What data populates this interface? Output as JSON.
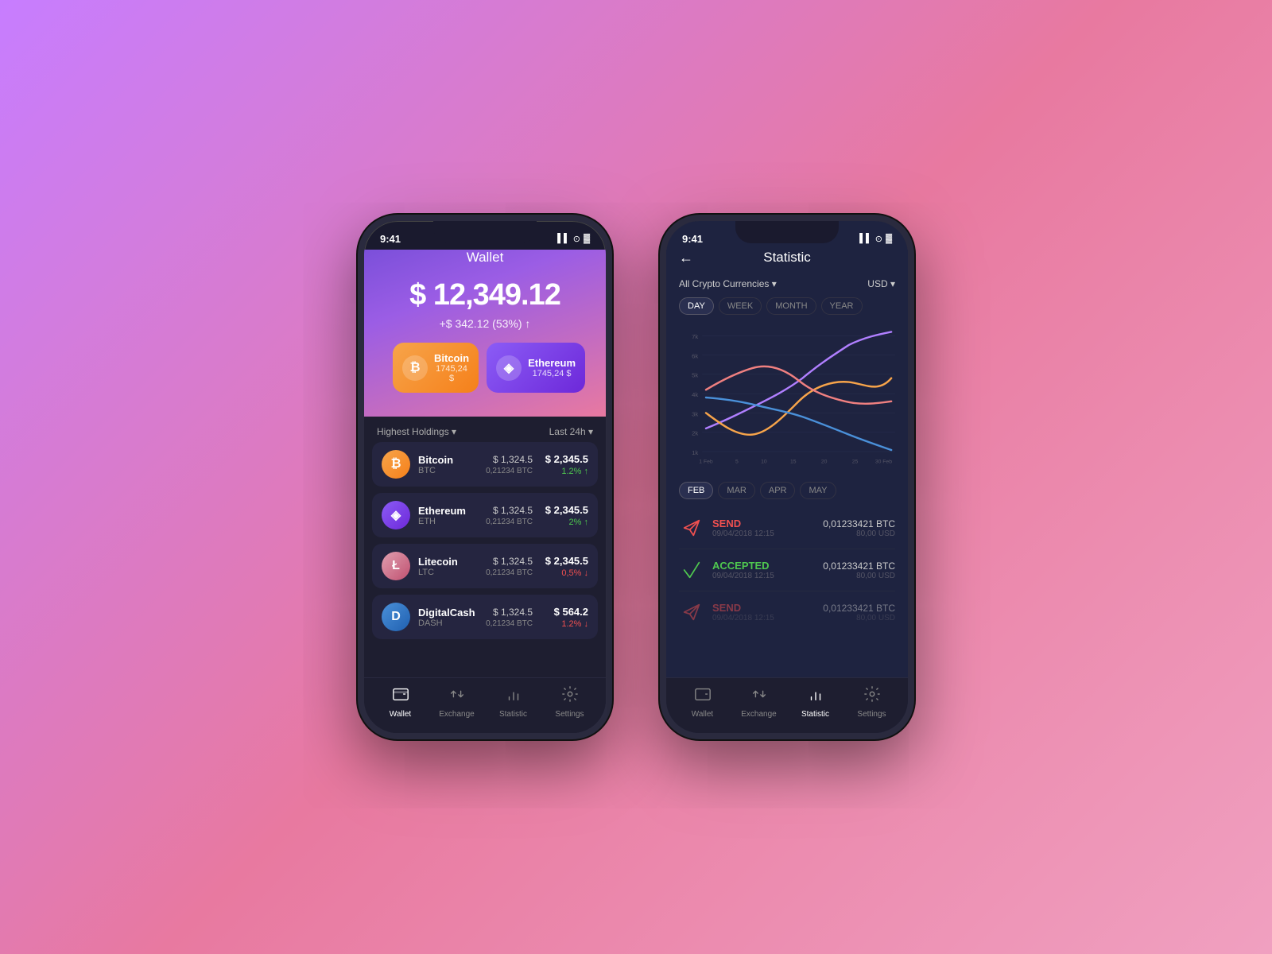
{
  "background": {
    "gradient": "linear-gradient(135deg, #c77dff, #e879a0, #f0a0c0)"
  },
  "phone1": {
    "status": {
      "time": "9:41",
      "icons": "▌▌ ⊙ ▓"
    },
    "header": {
      "title": "Wallet",
      "amount": "$ 12,349.12",
      "change": "+$ 342.12 (53%) ↑"
    },
    "cards": [
      {
        "name": "Bitcoin",
        "value": "1745,24 $",
        "symbol": "₿",
        "type": "bitcoin"
      },
      {
        "name": "Ethereum",
        "value": "1745,24 $",
        "symbol": "◈",
        "type": "ethereum"
      }
    ],
    "list_header": {
      "left": "Highest Holdings ▾",
      "right": "Last 24h ▾"
    },
    "coins": [
      {
        "name": "Bitcoin",
        "symbol": "BTC",
        "price": "$ 1,324.5",
        "btc": "0,21234 BTC",
        "value": "$ 2,345.5",
        "change": "1.2% ↑",
        "trend": "up",
        "icon": "₿",
        "class": "btc"
      },
      {
        "name": "Ethereum",
        "symbol": "ETH",
        "price": "$ 1,324.5",
        "btc": "0,21234 BTC",
        "value": "$ 2,345.5",
        "change": "2% ↑",
        "trend": "up",
        "icon": "◈",
        "class": "eth"
      },
      {
        "name": "Litecoin",
        "symbol": "LTC",
        "price": "$ 1,324.5",
        "btc": "0,21234 BTC",
        "value": "$ 2,345.5",
        "change": "0,5% ↓",
        "trend": "down",
        "icon": "Ł",
        "class": "ltc"
      },
      {
        "name": "DigitalCash",
        "symbol": "DASH",
        "price": "$ 1,324.5",
        "btc": "0,21234 BTC",
        "value": "$ 564.2",
        "change": "1.2% ↓",
        "trend": "down",
        "icon": "D",
        "class": "dash"
      }
    ],
    "nav": [
      {
        "label": "Wallet",
        "active": true
      },
      {
        "label": "Exchange",
        "active": false
      },
      {
        "label": "Statistic",
        "active": false
      },
      {
        "label": "Settings",
        "active": false
      }
    ]
  },
  "phone2": {
    "status": {
      "time": "9:41",
      "icons": "▌▌ ⊙ ▓"
    },
    "header": {
      "title": "Statistic",
      "back": "←"
    },
    "filters": {
      "currency_label": "All Crypto Currencies ▾",
      "unit_label": "USD ▾"
    },
    "time_tabs": [
      "DAY",
      "WEEK",
      "MONTH",
      "YEAR"
    ],
    "active_time_tab": "DAY",
    "chart": {
      "y_labels": [
        "7k",
        "6k",
        "5k",
        "4k",
        "3k",
        "2k",
        "1k"
      ],
      "x_labels": [
        "1 Feb",
        "5",
        "10",
        "15",
        "20",
        "25",
        "30 Feb"
      ],
      "lines": [
        {
          "color": "#c77dff",
          "label": "purple"
        },
        {
          "color": "#f7a44a",
          "label": "orange"
        },
        {
          "color": "#f08080",
          "label": "pink"
        },
        {
          "color": "#4a90d9",
          "label": "blue"
        }
      ]
    },
    "month_tabs": [
      "FEB",
      "MAR",
      "APR",
      "MAY"
    ],
    "active_month_tab": "FEB",
    "transactions": [
      {
        "type": "SEND",
        "trend": "send",
        "date": "09/04/2018 12:15",
        "btc": "0,01233421 BTC",
        "usd": "80,00 USD"
      },
      {
        "type": "ACCEPTED",
        "trend": "accepted",
        "date": "09/04/2018 12:15",
        "btc": "0,01233421 BTC",
        "usd": "80,00 USD"
      },
      {
        "type": "SEND",
        "trend": "send",
        "date": "09/04/2018 12:15",
        "btc": "0,01233421 BTC",
        "usd": "80,00 USD"
      }
    ],
    "nav": [
      {
        "label": "Wallet",
        "active": false
      },
      {
        "label": "Exchange",
        "active": false
      },
      {
        "label": "Statistic",
        "active": true
      },
      {
        "label": "Settings",
        "active": false
      }
    ]
  }
}
